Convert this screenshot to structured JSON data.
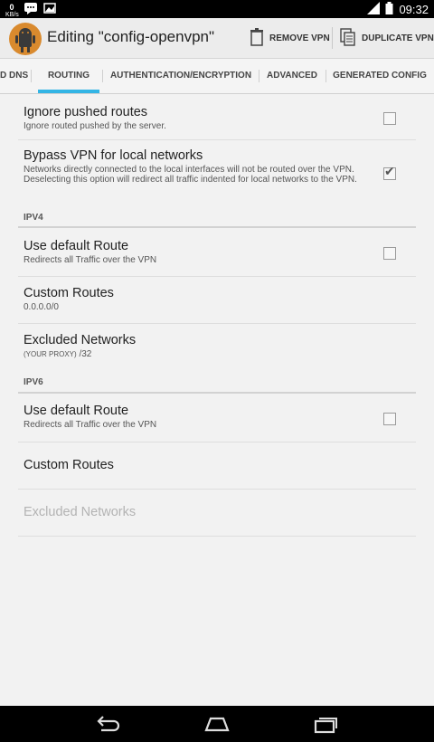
{
  "statusbar": {
    "kbs_value": "0",
    "kbs_unit": "KB/s",
    "time": "09:32"
  },
  "actionbar": {
    "title": "Editing \"config-openvpn\"",
    "remove_label": "REMOVE VPN",
    "duplicate_label": "DUPLICATE VPN"
  },
  "tabs": [
    {
      "label": "D DNS"
    },
    {
      "label": "ROUTING"
    },
    {
      "label": "AUTHENTICATION/ENCRYPTION"
    },
    {
      "label": "ADVANCED"
    },
    {
      "label": "GENERATED CONFIG"
    }
  ],
  "active_tab": "ROUTING",
  "prefs": {
    "ignore_pushed": {
      "title": "Ignore pushed routes",
      "summary": "Ignore routed pushed by the server.",
      "checked": false
    },
    "bypass_local": {
      "title": "Bypass VPN for local networks",
      "summary": "Networks directly connected to the local interfaces will not be routed over the VPN. Deselecting this option will redirect all traffic indented for local networks to the VPN.",
      "checked": true
    },
    "ipv4_header": "IPV4",
    "ipv4_default_route": {
      "title": "Use default Route",
      "summary": "Redirects all Traffic over the VPN",
      "checked": false
    },
    "ipv4_custom_routes": {
      "title": "Custom Routes",
      "summary": "0.0.0.0/0"
    },
    "ipv4_excluded": {
      "title": "Excluded Networks",
      "summary_prefix": "(YOUR PROXY)",
      "summary_suffix": "/32"
    },
    "ipv6_header": "IPV6",
    "ipv6_default_route": {
      "title": "Use default Route",
      "summary": "Redirects all Traffic over the VPN",
      "checked": false
    },
    "ipv6_custom_routes": {
      "title": "Custom Routes"
    },
    "ipv6_excluded": {
      "title": "Excluded Networks",
      "enabled": false
    }
  },
  "colors": {
    "accent": "#33b5e5",
    "app_icon": "#d98a2e"
  }
}
